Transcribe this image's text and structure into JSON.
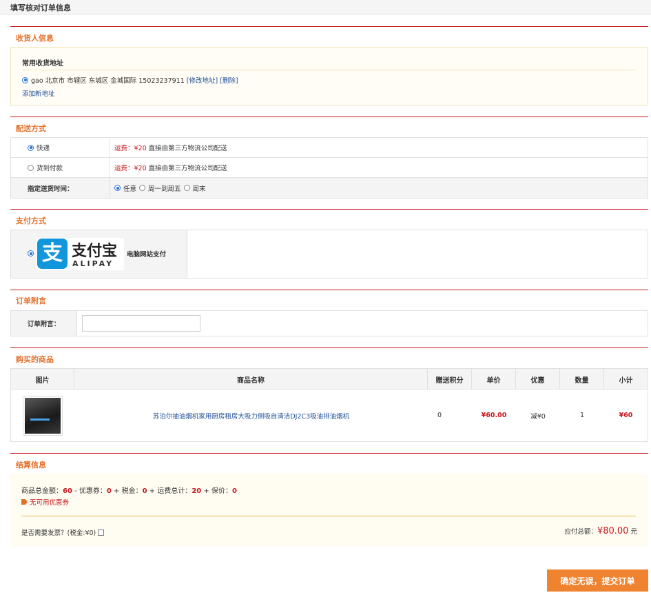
{
  "page_title": "填写核对订单信息",
  "receiver": {
    "section_title": "收货人信息",
    "heading": "常用收货地址",
    "address": "gao 北京市 市辖区 东城区 金城国际 15023237911",
    "edit_link": "[修改地址]",
    "delete_link": "[删除]",
    "add_link": "添加新地址"
  },
  "delivery": {
    "section_title": "配送方式",
    "options": [
      {
        "label": "快递",
        "fee_label": "运费：¥20",
        "note": "直接由第三方物流公司配送",
        "selected": true
      },
      {
        "label": "货到付款",
        "fee_label": "运费：¥20",
        "note": "直接由第三方物流公司配送",
        "selected": false
      }
    ],
    "time_label": "指定送货时间：",
    "time_options": [
      {
        "label": "任意",
        "selected": true
      },
      {
        "label": "周一到周五",
        "selected": false
      },
      {
        "label": "周末",
        "selected": false
      }
    ]
  },
  "payment": {
    "section_title": "支付方式",
    "logo_cn": "支付宝",
    "logo_en": "ALIPAY",
    "logo_mark": "支",
    "label": "电脑网站支付"
  },
  "memo": {
    "section_title": "订单附言",
    "label": "订单附言：",
    "value": ""
  },
  "goods": {
    "section_title": "购买的商品",
    "headers": [
      "图片",
      "商品名称",
      "赠送积分",
      "单价",
      "优惠",
      "数量",
      "小计"
    ],
    "rows": [
      {
        "name": "苏泊尔抽油烟机家用厨房租房大吸力侧吸自清洁DJ2C3吸油排油烟机",
        "points": "0",
        "price": "¥60.00",
        "discount": "减¥0",
        "qty": "1",
        "subtotal": "¥60"
      }
    ]
  },
  "settlement": {
    "section_title": "结算信息",
    "goods_total_label": "商品总金额：",
    "goods_total": "60",
    "coupon_label": " - 优惠券：",
    "coupon": "0",
    "tax_label": " + 税金：",
    "tax": "0",
    "shipping_label": " + 运费总计：",
    "shipping": "20",
    "insurance_label": " + 保价：",
    "insurance": "0",
    "no_coupon": "无可用优惠券",
    "invoice_label": "是否需要发票？(税金:¥0)",
    "total_label": "应付总额：",
    "total_amount": "¥80.00",
    "total_unit": "元"
  },
  "submit_label": "确定无误，提交订单",
  "colors": {
    "accent_orange": "#e4702b",
    "section_line": "#c8161d",
    "price_red": "#c8161d",
    "link_blue": "#1f4e96",
    "alipay_blue": "#1296db",
    "button_orange": "#f08330"
  }
}
